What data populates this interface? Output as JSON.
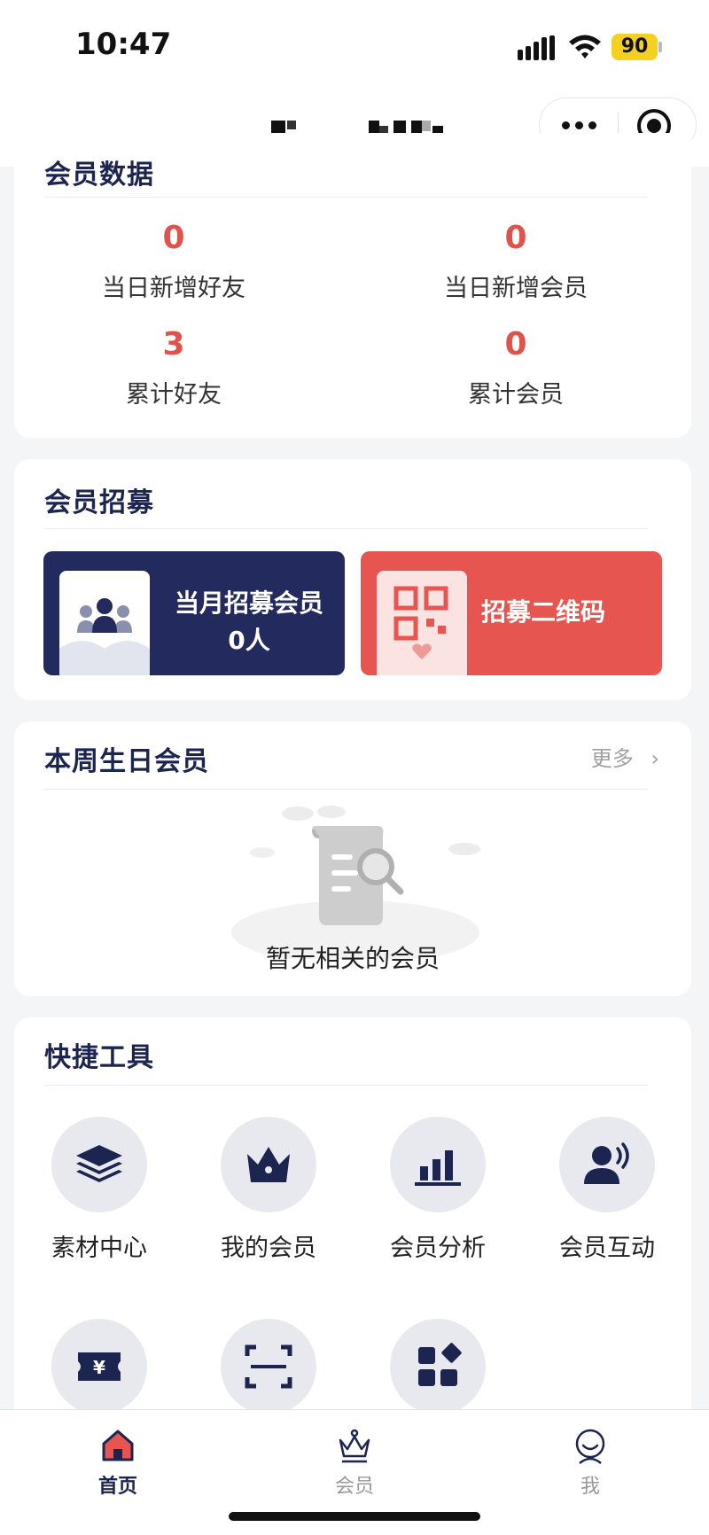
{
  "status_bar": {
    "time": "10:47",
    "battery": "90"
  },
  "nav": {
    "title": "",
    "more_icon": "more-dots-icon",
    "close_icon": "target-close-icon"
  },
  "stats": {
    "title": "会员数据",
    "items": [
      {
        "value": "0",
        "label": "当日新增好友"
      },
      {
        "value": "0",
        "label": "当日新增会员"
      },
      {
        "value": "3",
        "label": "累计好友"
      },
      {
        "value": "0",
        "label": "累计会员"
      }
    ]
  },
  "recruit": {
    "title": "会员招募",
    "monthly_label": "当月招募会员",
    "monthly_value": "0人",
    "qr_label": "招募二维码"
  },
  "birthday": {
    "title": "本周生日会员",
    "more": "更多",
    "empty": "暂无相关的会员"
  },
  "tools": {
    "title": "快捷工具",
    "items": [
      {
        "label": "素材中心",
        "icon": "layers-icon"
      },
      {
        "label": "我的会员",
        "icon": "crown-icon"
      },
      {
        "label": "会员分析",
        "icon": "bar-chart-icon"
      },
      {
        "label": "会员互动",
        "icon": "user-voice-icon"
      },
      {
        "label": "",
        "icon": "coupon-yen-icon"
      },
      {
        "label": "",
        "icon": "scan-icon"
      },
      {
        "label": "",
        "icon": "apps-grid-icon"
      }
    ]
  },
  "tab_bar": {
    "items": [
      {
        "label": "首页",
        "icon": "home-icon",
        "active": true
      },
      {
        "label": "会员",
        "icon": "crown-tab-icon",
        "active": false
      },
      {
        "label": "我",
        "icon": "profile-icon",
        "active": false
      }
    ]
  },
  "colors": {
    "navy": "#222a5e",
    "red": "#e65550",
    "accent_value": "#e0524a"
  }
}
